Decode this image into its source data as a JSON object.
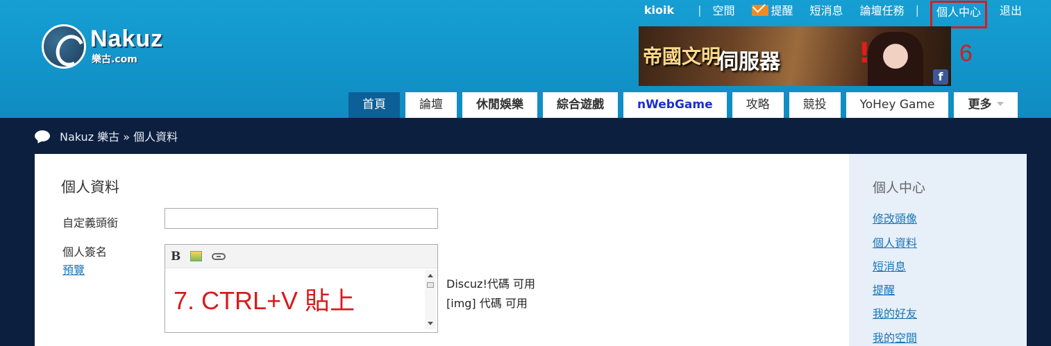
{
  "brand": {
    "name": "Nakuz",
    "sub": "樂古.com"
  },
  "topnav": {
    "username": "kioik",
    "space": "空間",
    "reminder": "提醒",
    "messages": "短消息",
    "tasks": "論壇任務",
    "profile_center": "個人中心",
    "logout": "退出"
  },
  "banner": {
    "title": "帝國文明",
    "server": "伺服器",
    "exclaim": "!"
  },
  "annotations": {
    "step6": "6",
    "step7": "7. CTRL+V 貼上",
    "annotation_color": "#d91b1b"
  },
  "mainnav": {
    "tabs": [
      {
        "label": "首頁"
      },
      {
        "label": "論壇"
      },
      {
        "label": "休閒娛樂"
      },
      {
        "label": "綜合遊戲"
      },
      {
        "label": "nWebGame"
      },
      {
        "label": "攻略"
      },
      {
        "label": "競投"
      },
      {
        "label": "YoHey Game"
      },
      {
        "label": "更多"
      }
    ]
  },
  "breadcrumb": {
    "text": "Nakuz 樂古 » 個人資料"
  },
  "form": {
    "title": "個人資料",
    "custom_title_label": "自定義頭銜",
    "custom_title_value": "",
    "signature_label": "個人簽名",
    "preview_link": "預覽",
    "toolbar": {
      "bold": "B"
    },
    "hint_discuz": "Discuz!代碼 可用",
    "hint_img": "[img] 代碼 可用"
  },
  "sidebar": {
    "title": "個人中心",
    "items": [
      {
        "label": "修改頭像"
      },
      {
        "label": "個人資料"
      },
      {
        "label": "短消息"
      },
      {
        "label": "提醒"
      },
      {
        "label": "我的好友"
      },
      {
        "label": "我的空間"
      }
    ]
  },
  "colors": {
    "header": "#169fd3",
    "page_bg": "#0d1f3f",
    "active_tab": "#0d5f97",
    "link": "#1a75b8"
  }
}
